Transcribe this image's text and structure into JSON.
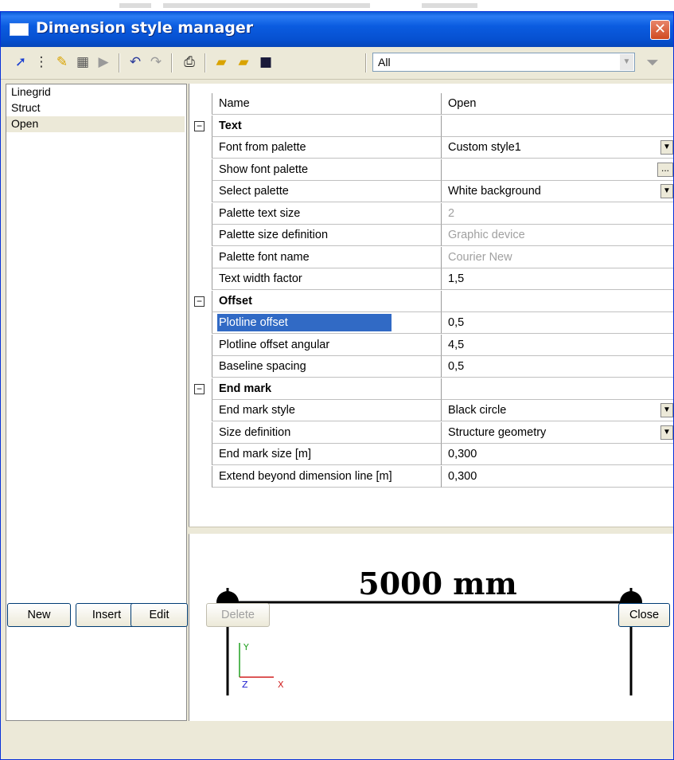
{
  "window": {
    "title": "Dimension style manager"
  },
  "toolbar": {
    "icons": [
      "new-style-icon",
      "import-icon",
      "edit-icon",
      "copy-icon",
      "cursor-icon",
      "undo-icon",
      "redo-icon",
      "print-icon",
      "open-folder-icon",
      "open-folder-2-icon",
      "save-icon"
    ],
    "filter_value": "All",
    "filter_options": [
      "All"
    ]
  },
  "styles_list": {
    "items": [
      {
        "label": "Linegrid",
        "selected": false
      },
      {
        "label": "Struct",
        "selected": false
      },
      {
        "label": "Open",
        "selected": true
      }
    ]
  },
  "properties": {
    "rows": [
      {
        "name": "Name",
        "value": "Open",
        "kind": "plain"
      },
      {
        "name": "Text",
        "value": "",
        "kind": "group"
      },
      {
        "name": "Font from palette",
        "value": "Custom style1",
        "kind": "dropdown"
      },
      {
        "name": "Show font palette",
        "value": "",
        "kind": "ellipsis"
      },
      {
        "name": "Select palette",
        "value": "White background",
        "kind": "dropdown"
      },
      {
        "name": "Palette text size",
        "value": "2",
        "kind": "disabled"
      },
      {
        "name": "Palette size definition",
        "value": "Graphic device",
        "kind": "disabled"
      },
      {
        "name": "Palette font name",
        "value": "Courier New",
        "kind": "disabled"
      },
      {
        "name": "Text width factor",
        "value": "1,5",
        "kind": "plain"
      },
      {
        "name": "Offset",
        "value": "",
        "kind": "group"
      },
      {
        "name": "Plotline offset",
        "value": "0,5",
        "kind": "selected"
      },
      {
        "name": "Plotline offset angular",
        "value": "4,5",
        "kind": "plain"
      },
      {
        "name": "Baseline spacing",
        "value": "0,5",
        "kind": "plain"
      },
      {
        "name": "End mark",
        "value": "",
        "kind": "group"
      },
      {
        "name": "End mark style",
        "value": "Black circle",
        "kind": "dropdown"
      },
      {
        "name": "Size definition",
        "value": "Structure geometry",
        "kind": "dropdown"
      },
      {
        "name": "End mark size [m]",
        "value": "0,300",
        "kind": "plain"
      },
      {
        "name": "Extend beyond dimension line [m]",
        "value": "0,300",
        "kind": "plain"
      }
    ]
  },
  "preview": {
    "dimension_text": "5000 mm",
    "axis_y": "Y",
    "axis_x": "X",
    "axis_z": "Z",
    "colors": {
      "axis_y": "#20a020",
      "axis_x": "#d02020",
      "axis_z": "#2020d0"
    }
  },
  "buttons": {
    "new": "New",
    "insert": "Insert",
    "edit": "Edit",
    "delete": "Delete",
    "close": "Close"
  }
}
